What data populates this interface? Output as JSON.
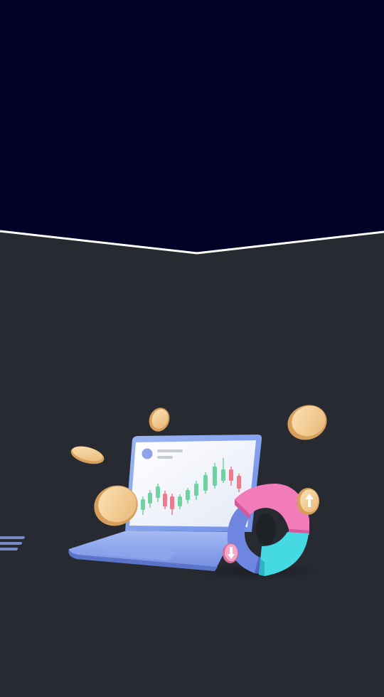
{
  "theme": {
    "header_color": "#020026",
    "background_color": "#272a31",
    "divider_color": "#ffffff"
  },
  "illustration": {
    "icons": [
      "laptop-icon",
      "candlestick-chart-icon",
      "coin-icon",
      "donut-chart-icon",
      "arrow-up-icon",
      "arrow-down-icon"
    ],
    "candle_colors": {
      "up": "#6fd3a1",
      "down": "#f07a8c"
    }
  }
}
